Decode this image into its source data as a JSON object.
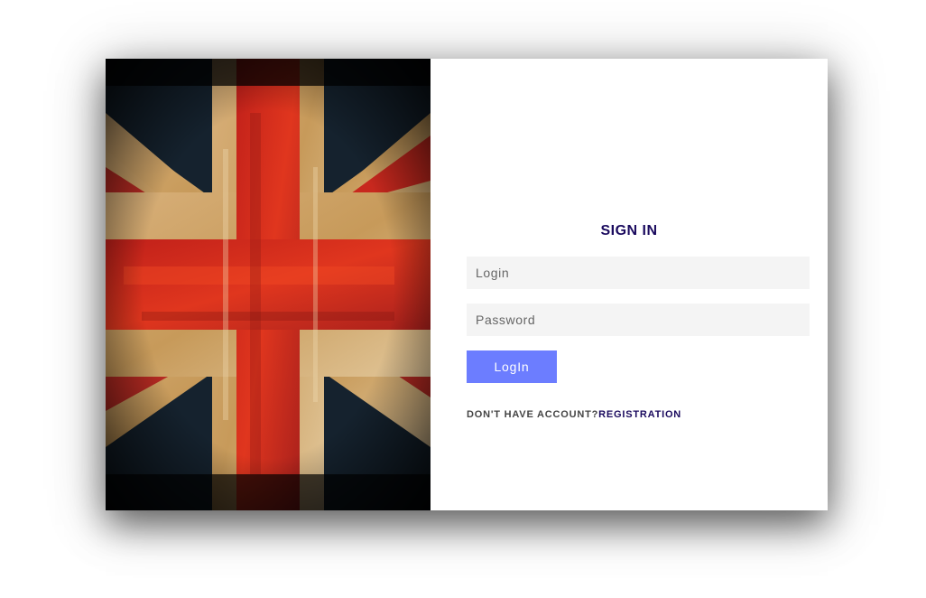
{
  "form": {
    "title": "SIGN IN",
    "login_placeholder": "Login",
    "password_placeholder": "Password",
    "submit_label": "LogIn",
    "no_account_text": "DON'T HAVE ACCOUNT?",
    "registration_link": "REGISTRATION"
  },
  "image": {
    "subject": "grunge-union-jack-flag"
  },
  "colors": {
    "title": "#1a0a5e",
    "button": "#6c7dff",
    "field_background": "#f4f4f4",
    "link": "#1a0a5e"
  }
}
